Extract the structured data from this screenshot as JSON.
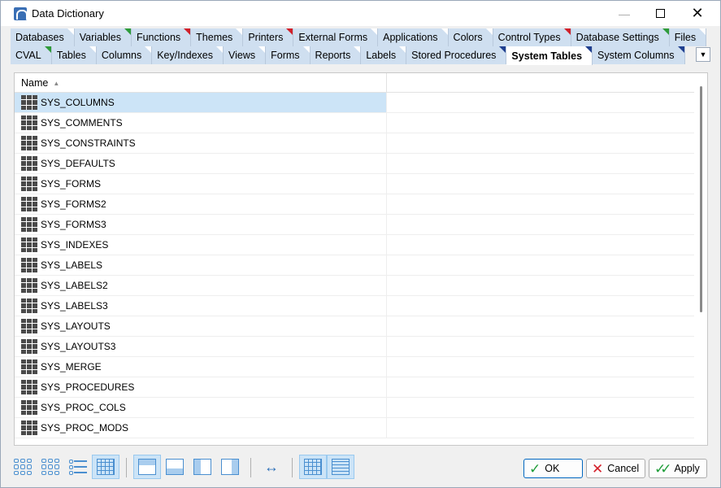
{
  "window": {
    "title": "Data Dictionary"
  },
  "tabs_row1": [
    {
      "label": "Databases",
      "marker": "none"
    },
    {
      "label": "Variables",
      "marker": "green"
    },
    {
      "label": "Functions",
      "marker": "red"
    },
    {
      "label": "Themes",
      "marker": "none"
    },
    {
      "label": "Printers",
      "marker": "red"
    },
    {
      "label": "External Forms",
      "marker": "none"
    },
    {
      "label": "Applications",
      "marker": "none"
    },
    {
      "label": "Colors",
      "marker": "none"
    },
    {
      "label": "Control Types",
      "marker": "red"
    },
    {
      "label": "Database Settings",
      "marker": "green"
    },
    {
      "label": "Files",
      "marker": "none"
    }
  ],
  "tabs_row2": [
    {
      "label": "CVAL",
      "marker": "green"
    },
    {
      "label": "Tables",
      "marker": "none"
    },
    {
      "label": "Columns",
      "marker": "none"
    },
    {
      "label": "Key/Indexes",
      "marker": "none"
    },
    {
      "label": "Views",
      "marker": "none"
    },
    {
      "label": "Forms",
      "marker": "none"
    },
    {
      "label": "Reports",
      "marker": "none"
    },
    {
      "label": "Labels",
      "marker": "none"
    },
    {
      "label": "Stored Procedures",
      "marker": "blue"
    },
    {
      "label": "System Tables",
      "marker": "blue",
      "active": true
    },
    {
      "label": "System Columns",
      "marker": "blue"
    }
  ],
  "grid": {
    "column_header": "Name",
    "rows": [
      "SYS_COLUMNS",
      "SYS_COMMENTS",
      "SYS_CONSTRAINTS",
      "SYS_DEFAULTS",
      "SYS_FORMS",
      "SYS_FORMS2",
      "SYS_FORMS3",
      "SYS_INDEXES",
      "SYS_LABELS",
      "SYS_LABELS2",
      "SYS_LABELS3",
      "SYS_LAYOUTS",
      "SYS_LAYOUTS3",
      "SYS_MERGE",
      "SYS_PROCEDURES",
      "SYS_PROC_COLS",
      "SYS_PROC_MODS"
    ],
    "selected_index": 0
  },
  "buttons": {
    "ok": "OK",
    "cancel": "Cancel",
    "apply": "Apply"
  },
  "colors": {
    "tab_bg": "#cfdff0",
    "selected_row": "#cce4f7",
    "accent": "#0067c0"
  }
}
